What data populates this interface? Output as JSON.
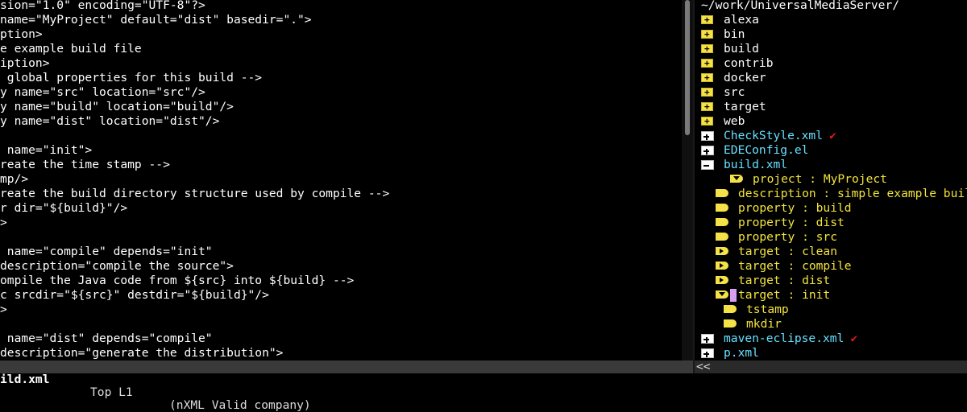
{
  "editor": {
    "lines": [
      {
        "text": "sion=\"1.0\" encoding=\"UTF-8\"?>",
        "kind": "plain"
      },
      {
        "text": "name=\"MyProject\" default=\"dist\" basedir=\".\">",
        "kind": "plain"
      },
      {
        "text": "ption>",
        "kind": "plain"
      },
      {
        "text": "e example build file",
        "kind": "plain"
      },
      {
        "text": "iption>",
        "kind": "plain"
      },
      {
        "text": " global properties for this build -->",
        "kind": "comment"
      },
      {
        "text": "y name=\"src\" location=\"src\"/>",
        "kind": "plain"
      },
      {
        "text": "y name=\"build\" location=\"build\"/>",
        "kind": "plain"
      },
      {
        "text": "y name=\"dist\" location=\"dist\"/>",
        "kind": "plain"
      },
      {
        "text": "",
        "kind": "plain"
      },
      {
        "text": " name=\"init\">",
        "kind": "plain"
      },
      {
        "text": "reate the time stamp -->",
        "kind": "comment"
      },
      {
        "text": "mp/>",
        "kind": "plain"
      },
      {
        "text": "reate the build directory structure used by compile -->",
        "kind": "comment"
      },
      {
        "text": "r dir=\"${build}\"/>",
        "kind": "plain"
      },
      {
        "text": ">",
        "kind": "plain"
      },
      {
        "text": "",
        "kind": "plain"
      },
      {
        "text": " name=\"compile\" depends=\"init\"",
        "kind": "plain"
      },
      {
        "text": "description=\"compile the source\">",
        "kind": "plain"
      },
      {
        "text": "ompile the Java code from ${src} into ${build} -->",
        "kind": "comment"
      },
      {
        "text": "c srcdir=\"${src}\" destdir=\"${build}\"/>",
        "kind": "plain"
      },
      {
        "text": ">",
        "kind": "plain"
      },
      {
        "text": "",
        "kind": "plain"
      },
      {
        "text": " name=\"dist\" depends=\"compile\"",
        "kind": "plain"
      },
      {
        "text": "description=\"generate the distribution\">",
        "kind": "plain"
      }
    ]
  },
  "tree": {
    "path": "~/work/UniversalMediaServer/",
    "rows": [
      {
        "text": "alexa",
        "icon": "folder",
        "indent": 0,
        "kind": "dir"
      },
      {
        "text": "bin",
        "icon": "folder",
        "indent": 0,
        "kind": "dir"
      },
      {
        "text": "build",
        "icon": "folder",
        "indent": 0,
        "kind": "dir"
      },
      {
        "text": "contrib",
        "icon": "folder",
        "indent": 0,
        "kind": "dir"
      },
      {
        "text": "docker",
        "icon": "folder",
        "indent": 0,
        "kind": "dir"
      },
      {
        "text": "src",
        "icon": "folder",
        "indent": 0,
        "kind": "dir"
      },
      {
        "text": "target",
        "icon": "folder",
        "indent": 0,
        "kind": "dir"
      },
      {
        "text": "web",
        "icon": "folder",
        "indent": 0,
        "kind": "dir"
      },
      {
        "text": "CheckStyle.xml",
        "icon": "file-plus",
        "indent": 0,
        "kind": "file",
        "vc": true
      },
      {
        "text": "EDEConfig.el",
        "icon": "file-plus",
        "indent": 0,
        "kind": "file"
      },
      {
        "text": "build.xml",
        "icon": "file-minus",
        "indent": 0,
        "kind": "file"
      },
      {
        "text": "project : MyProject",
        "icon": "tag-expanded",
        "indent": 1,
        "kind": "tag"
      },
      {
        "text": "description : simple example build file",
        "icon": "tag",
        "indent": 2,
        "kind": "tag"
      },
      {
        "text": "property : build",
        "icon": "tag",
        "indent": 2,
        "kind": "tag"
      },
      {
        "text": "property : dist",
        "icon": "tag",
        "indent": 2,
        "kind": "tag"
      },
      {
        "text": "property : src",
        "icon": "tag",
        "indent": 2,
        "kind": "tag"
      },
      {
        "text": "target : clean",
        "icon": "tag-collapsed",
        "indent": 2,
        "kind": "tag"
      },
      {
        "text": "target : compile",
        "icon": "tag-collapsed",
        "indent": 2,
        "kind": "tag"
      },
      {
        "text": "target : dist",
        "icon": "tag-collapsed",
        "indent": 2,
        "kind": "tag"
      },
      {
        "text": "target : init",
        "icon": "tag-expanded",
        "indent": 2,
        "kind": "tag",
        "cursor": true
      },
      {
        "text": "tstamp",
        "icon": "tag",
        "indent": 3,
        "kind": "tag"
      },
      {
        "text": "mkdir",
        "icon": "tag",
        "indent": 3,
        "kind": "tag"
      },
      {
        "text": "maven-eclipse.xml",
        "icon": "file-plus",
        "indent": 0,
        "kind": "file",
        "vc": true
      },
      {
        "text": "p.xml",
        "icon": "file-plus",
        "indent": 0,
        "kind": "file"
      }
    ],
    "vc_mark": "✔"
  },
  "modeline": {
    "file": "ild.xml",
    "position": "Top L1",
    "mode": "(nXML Valid company)",
    "tree_label": "<<"
  },
  "colors": {
    "comment": "#3fd63f",
    "tag": "#f2e33d",
    "file": "#66e0ff"
  }
}
